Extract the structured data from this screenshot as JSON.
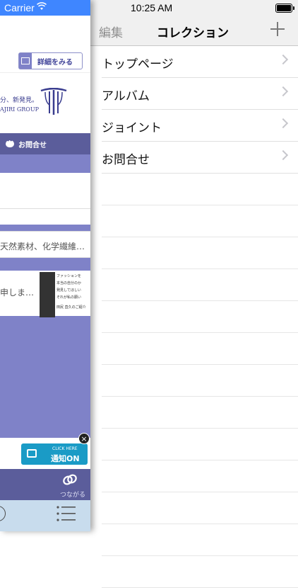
{
  "status_bar": {
    "carrier": "Carrier",
    "time": "10:25 AM"
  },
  "background_app": {
    "detail_button_label": "詳細をみる",
    "banner_text_line1": "分、新発見。",
    "banner_text_line2": "AJIRI GROUP",
    "inquiry_label": "お問合せ",
    "news_items": [
      "天然素材、化学繊維…",
      "申しま…"
    ],
    "thumb_caption_lines": [
      "ファッションを",
      "本当の自分のか",
      "発見してほしい",
      "それが私の願い",
      "田尻 直久のご紹介"
    ],
    "notify_small": "CLICK HERE",
    "notify_main": "通知ON",
    "close_glyph": "×",
    "connect_label": "つながる"
  },
  "navbar": {
    "edit_label": "編集",
    "title": "コレクション"
  },
  "collection_items": [
    "トップページ",
    "アルバム",
    "ジョイント",
    "お問合せ"
  ],
  "icons": {
    "wifi": "wifi-icon",
    "battery": "battery-icon",
    "add": "plus-icon",
    "chevron": "chevron-right-icon",
    "menu": "list-menu-icon",
    "connect": "link-icon"
  },
  "colors": {
    "status_left_bg": "#3f86ff",
    "left_bg": "#7f82c8",
    "left_dark_bar": "#5b5d9b",
    "notify_btn": "#1a9bc6",
    "navbar_bg": "#f0f0f0"
  }
}
